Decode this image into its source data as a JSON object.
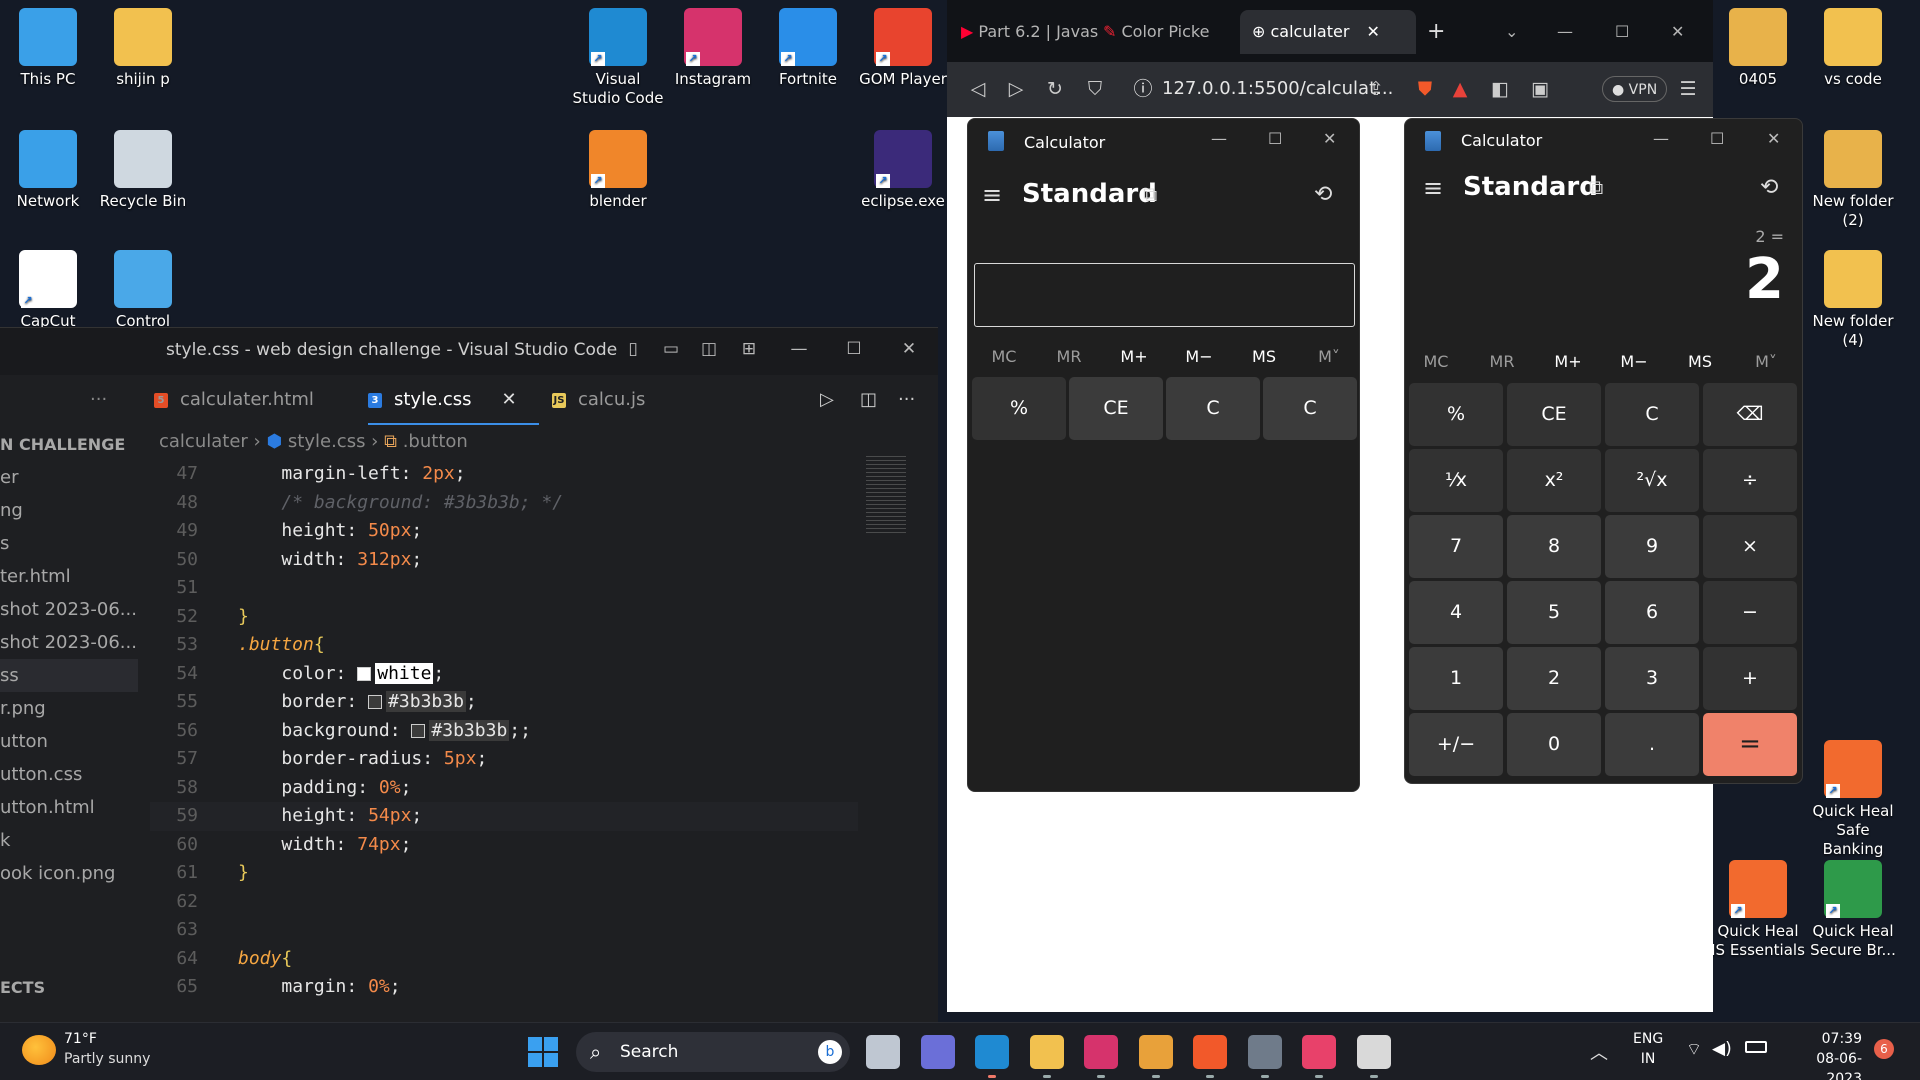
{
  "desktop": {
    "icons": [
      {
        "label": "This PC",
        "icon": "monitor-icon",
        "color": "#3aa0e8"
      },
      {
        "label": "shijin p",
        "icon": "user-folder-icon",
        "color": "#f2c14f"
      },
      {
        "label": "Visual Studio Code",
        "icon": "vscode-icon",
        "color": "#1f8ad2"
      },
      {
        "label": "Instagram",
        "icon": "instagram-icon",
        "color": "#d6336c"
      },
      {
        "label": "Fortnite",
        "icon": "fortnite-icon",
        "color": "#2a8ee8"
      },
      {
        "label": "GOM Player",
        "icon": "gom-player-icon",
        "color": "#e8442e"
      },
      {
        "label": "0405",
        "icon": "folder-icon",
        "color": "#e8b24a"
      },
      {
        "label": "vs code",
        "icon": "folder-icon",
        "color": "#f2c14f"
      },
      {
        "label": "Network",
        "icon": "network-icon",
        "color": "#3aa0e8"
      },
      {
        "label": "Recycle Bin",
        "icon": "recycle-bin-icon",
        "color": "#cfd8e0"
      },
      {
        "label": "blender",
        "icon": "blender-icon",
        "color": "#f0862a"
      },
      {
        "label": "eclipse.exe",
        "icon": "eclipse-icon",
        "color": "#3b2a7a"
      },
      {
        "label": "New folder (2)",
        "icon": "folder-icon",
        "color": "#e8b24a"
      },
      {
        "label": "CapCut",
        "icon": "capcut-icon",
        "color": "#ffffff"
      },
      {
        "label": "Control Panel",
        "icon": "control-panel-icon",
        "color": "#4aa8e8"
      },
      {
        "label": "New folder (4)",
        "icon": "folder-icon",
        "color": "#f2c14f"
      },
      {
        "label": "Quick Heal Safe Banking",
        "icon": "quick-heal-banking-icon",
        "color": "#f26a2e"
      },
      {
        "label": "Quick Heal IS Essentials",
        "icon": "quick-heal-icon",
        "color": "#f26a2e"
      },
      {
        "label": "Quick Heal Secure Br...",
        "icon": "quick-heal-browser-icon",
        "color": "#2e9a4a"
      }
    ]
  },
  "vscode": {
    "title": "style.css - web design challenge - Visual Studio Code",
    "tabs": [
      {
        "label": "calculater.html",
        "icon": "html-file-icon"
      },
      {
        "label": "style.css",
        "icon": "css-file-icon"
      },
      {
        "label": "calcu.js",
        "icon": "js-file-icon"
      }
    ],
    "more": "···",
    "breadcrumb": {
      "folder": "calculater",
      "file": "style.css",
      "symbol": ".button"
    },
    "sidebar": [
      "N CHALLENGE",
      "er",
      "ng",
      "s",
      "ter.html",
      "shot 2023-06...",
      "shot 2023-06...",
      "ss",
      "r.png",
      "utton",
      "utton.css",
      "utton.html",
      "k",
      "ook icon.png"
    ],
    "sidebar_footer": "ECTS",
    "lines": [
      {
        "n": "47",
        "indent": "    ",
        "prop": "margin-left:",
        "val": "2px",
        "end": ";"
      },
      {
        "n": "48",
        "indent": "    ",
        "comment": "/* background: #3b3b3b; */"
      },
      {
        "n": "49",
        "indent": "    ",
        "prop": "height:",
        "val": "50px",
        "end": ";"
      },
      {
        "n": "50",
        "indent": "    ",
        "prop": "width:",
        "val": "312px",
        "end": ";"
      },
      {
        "n": "51"
      },
      {
        "n": "52",
        "brace": "}"
      },
      {
        "n": "53",
        "selector": ".button",
        "brace": "{"
      },
      {
        "n": "54",
        "indent": "    ",
        "prop": "color:",
        "color": "white",
        "end": ";"
      },
      {
        "n": "55",
        "indent": "    ",
        "prop": "border:",
        "color": "#3b3b3b",
        "end": ";"
      },
      {
        "n": "56",
        "indent": "    ",
        "prop": "background:",
        "color": "#3b3b3b",
        "end": ";;"
      },
      {
        "n": "57",
        "indent": "    ",
        "prop": "border-radius:",
        "val": "5px",
        "end": ";"
      },
      {
        "n": "58",
        "indent": "    ",
        "prop": "padding:",
        "val": "0%",
        "end": ";"
      },
      {
        "n": "59",
        "indent": "    ",
        "prop": "height:",
        "val": "54px",
        "end": ";"
      },
      {
        "n": "60",
        "indent": "    ",
        "prop": "width:",
        "val": "74px",
        "end": ";"
      },
      {
        "n": "61",
        "brace": "}"
      },
      {
        "n": "62"
      },
      {
        "n": "63"
      },
      {
        "n": "64",
        "selector": "body",
        "brace": "{"
      },
      {
        "n": "65",
        "indent": "    ",
        "prop": "margin:",
        "val": "0%",
        "end": ";"
      }
    ]
  },
  "browser": {
    "tabs": [
      {
        "label": "Part 6.2 | Javas",
        "icon": "youtube-icon"
      },
      {
        "label": "Color Picke",
        "icon": "color-picker-icon"
      },
      {
        "label": "calculater",
        "icon": "globe-icon"
      }
    ],
    "url": "127.0.0.1:5500/calculat...",
    "vpn": "VPN"
  },
  "web_calc": {
    "title": "Calculator",
    "mode": "Standard",
    "memory": [
      "MC",
      "MR",
      "M+",
      "M−",
      "MS",
      "M˅"
    ],
    "buttons": [
      "%",
      "CE",
      "C",
      "C"
    ]
  },
  "native_calc": {
    "title": "Calculator",
    "mode": "Standard",
    "expression": "2 =",
    "display": "2",
    "memory": [
      "MC",
      "MR",
      "M+",
      "M−",
      "MS",
      "M˅"
    ],
    "buttons": [
      "%",
      "CE",
      "C",
      "⌫",
      "⅟x",
      "x²",
      "²√x",
      "÷",
      "7",
      "8",
      "9",
      "×",
      "4",
      "5",
      "6",
      "−",
      "1",
      "2",
      "3",
      "+",
      "+/−",
      "0",
      ".",
      "="
    ]
  },
  "taskbar": {
    "weather_temp": "71°F",
    "weather_text": "Partly sunny",
    "search": "Search",
    "lang": "ENG",
    "region": "IN",
    "time": "07:39",
    "date": "08-06-2023",
    "notifications": "6",
    "apps": [
      "file-explorer-icon",
      "teams-icon",
      "vscode-icon",
      "folder-icon",
      "instagram-icon",
      "chrome-icon",
      "brave-icon",
      "calculator-icon",
      "capcut-icon",
      "snipping-tool-icon"
    ]
  }
}
